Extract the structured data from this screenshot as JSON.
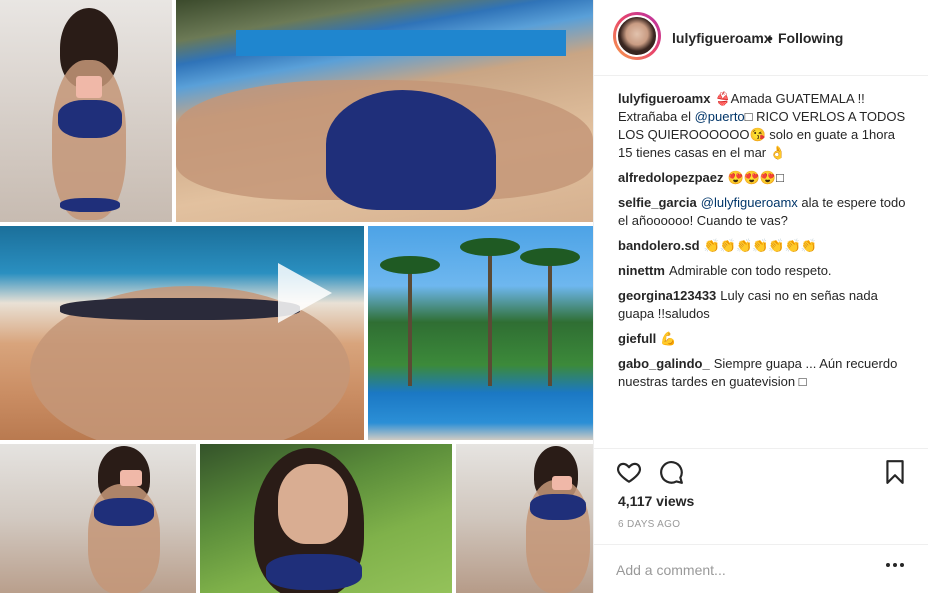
{
  "post": {
    "username": "lulyfigueroamx",
    "dot": "•",
    "follow_status": "Following",
    "views": "4,117 views",
    "posted": "6 DAYS AGO",
    "add_comment_placeholder": "Add a comment..."
  },
  "comments": [
    {
      "user": "lulyfigueroamx",
      "parts": [
        {
          "text": "👙Amada GUATEMALA !! Extrañaba el ",
          "mention": false
        },
        {
          "text": "@puerto",
          "mention": true
        },
        {
          "text": "□ RICO VERLOS A TODOS LOS QUIEROOOOOO😘 solo en guate a 1hora 15 tienes casas en el mar 👌",
          "mention": false
        }
      ]
    },
    {
      "user": "alfredolopezpaez",
      "parts": [
        {
          "text": "😍😍😍□",
          "mention": false
        }
      ]
    },
    {
      "user": "selfie_garcia",
      "parts": [
        {
          "text": "@lulyfigueroamx",
          "mention": true
        },
        {
          "text": " ala te espere todo el añoooooo! Cuando te vas?",
          "mention": false
        }
      ]
    },
    {
      "user": "bandolero.sd",
      "parts": [
        {
          "text": "👏👏👏👏👏👏👏",
          "mention": false
        }
      ]
    },
    {
      "user": "ninettm",
      "parts": [
        {
          "text": "Admirable con todo respeto.",
          "mention": false
        }
      ]
    },
    {
      "user": "georgina123433",
      "parts": [
        {
          "text": "Luly casi no en señas nada guapa !!saludos",
          "mention": false
        }
      ]
    },
    {
      "user": "giefull",
      "parts": [
        {
          "text": "💪",
          "mention": false
        }
      ]
    },
    {
      "user": "gabo_galindo_",
      "parts": [
        {
          "text": "Siempre guapa ... Aún recuerdo nuestras tardes en guatevision □",
          "mention": false
        }
      ]
    }
  ],
  "icons": {
    "like": "heart-icon",
    "comment": "comment-icon",
    "save": "bookmark-icon",
    "more": "more-options-icon",
    "play": "play-icon"
  },
  "colors": {
    "text": "#262626",
    "muted": "#999999",
    "mention": "#003569",
    "divider": "#efefef"
  }
}
